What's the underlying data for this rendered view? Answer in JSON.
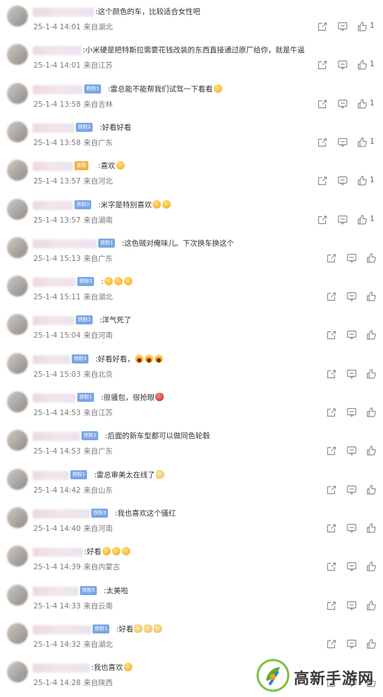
{
  "icons": {
    "repost": "share-icon",
    "comment": "comment-icon",
    "like": "thumbs-up-icon"
  },
  "colors": {
    "fan_badge_blue": "#7aa6e6",
    "fan_badge_gold": "#f0b44c",
    "icon_gray": "#8c8c8c"
  },
  "comments": [
    {
      "text": ":这个颜色的车，比较适合女性吧",
      "date": "25-1-4 14:01",
      "location": "来自湖北",
      "likes": "1",
      "fan_badge": "",
      "emojis": []
    },
    {
      "text": ":小米硬是把特斯拉需要花钱改装的东西直接通过原厂给你，就是牛逼",
      "date": "25-1-4 14:01",
      "location": "来自江苏",
      "likes": "1",
      "fan_badge": "",
      "emojis": []
    },
    {
      "text": ":雷总能不能帮我们试驾一下看看",
      "date": "25-1-4 13:58",
      "location": "来自吉林",
      "likes": "1",
      "fan_badge": "铁粉1",
      "emojis": [
        "emo"
      ]
    },
    {
      "text": ":好看好看",
      "date": "25-1-4 13:58",
      "location": "来自广东",
      "likes": "1",
      "fan_badge": "铁粉2",
      "emojis": []
    },
    {
      "text": ":喜欢",
      "date": "25-1-4 13:57",
      "location": "来自河北",
      "likes": "1",
      "fan_badge": "金粉",
      "emojis": [
        "emo"
      ]
    },
    {
      "text": ":米字是特别喜欢",
      "date": "25-1-4 13:57",
      "location": "来自湖南",
      "likes": "1",
      "fan_badge": "铁粉2",
      "emojis": [
        "emo",
        "emo"
      ]
    },
    {
      "text": ":这色贼对俺味儿。下次换车换这个",
      "date": "25-1-4 15:13",
      "location": "来自广东",
      "likes": "",
      "fan_badge": "铁粉1",
      "emojis": []
    },
    {
      "text": ":",
      "date": "25-1-4 15:11",
      "location": "来自湖北",
      "likes": "",
      "fan_badge": "铁粉3",
      "emojis": [
        "emo",
        "emo",
        "emo"
      ]
    },
    {
      "text": ":洋气死了",
      "date": "25-1-4 15:04",
      "location": "来自河南",
      "likes": "",
      "fan_badge": "铁粉1",
      "emojis": []
    },
    {
      "text": ":好看好看，",
      "date": "25-1-4 15:03",
      "location": "来自北京",
      "likes": "",
      "fan_badge": "铁粉1",
      "emojis": [
        "grin",
        "grin",
        "grin"
      ]
    },
    {
      "text": ":很骚包，很抢眼",
      "date": "25-1-4 14:53",
      "location": "来自江苏",
      "likes": "",
      "fan_badge": "铁粉1",
      "emojis": [
        "red"
      ]
    },
    {
      "text": ":后面的新车型都可以做同色轮毂",
      "date": "25-1-4 14:53",
      "location": "来自广东",
      "likes": "",
      "fan_badge": "铁粉2",
      "emojis": []
    },
    {
      "text": ":雷总审美太在线了",
      "date": "25-1-4 14:42",
      "location": "来自山东",
      "likes": "",
      "fan_badge": "铁粉1",
      "emojis": [
        "thumb"
      ]
    },
    {
      "text": ":我也喜欢这个骚红",
      "date": "25-1-4 14:40",
      "location": "来自河南",
      "likes": "",
      "fan_badge": "铁粉3",
      "emojis": []
    },
    {
      "text": ":好看",
      "date": "25-1-4 14:39",
      "location": "来自内蒙古",
      "likes": "",
      "fan_badge": "",
      "emojis": [
        "emo",
        "emo",
        "emo"
      ]
    },
    {
      "text": ":太美啦",
      "date": "25-1-4 14:33",
      "location": "来自云南",
      "likes": "",
      "fan_badge": "铁粉5",
      "emojis": []
    },
    {
      "text": ":好看",
      "date": "25-1-4 14:32",
      "location": "来自湖北",
      "likes": "",
      "fan_badge": "铁粉1",
      "emojis": [
        "thumb",
        "thumb",
        "thumb"
      ]
    },
    {
      "text": ":我也喜欢",
      "date": "25-1-4 14:28",
      "location": "来自陕西",
      "likes": "",
      "fan_badge": "",
      "emojis": [
        "emo"
      ]
    }
  ],
  "watermark": {
    "text": "高新手游网"
  }
}
